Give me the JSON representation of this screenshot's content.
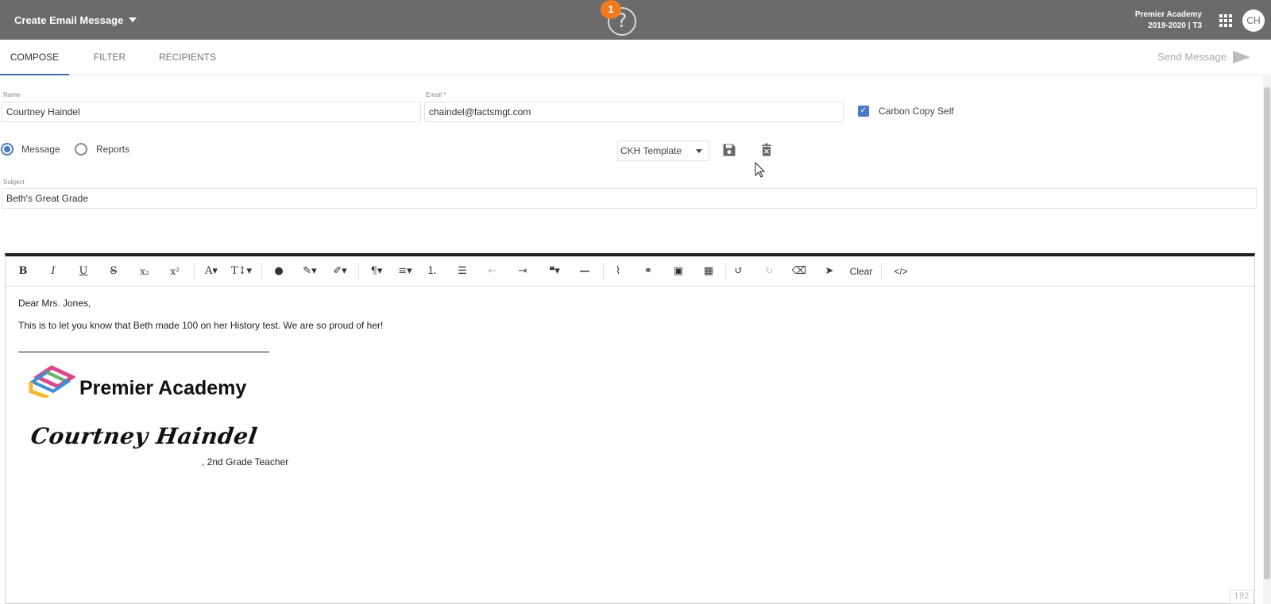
{
  "header": {
    "title": "Create Email Message",
    "help_badge": "1",
    "help_glyph": "?",
    "school_name": "Premier Academy",
    "school_term": "2019-2020 | T3",
    "avatar_initials": "CH",
    "bg_color": "#6b6b6b",
    "badge_color": "#f07b1d"
  },
  "tabs": [
    {
      "label": "COMPOSE",
      "active": true
    },
    {
      "label": "FILTER",
      "active": false
    },
    {
      "label": "RECIPIENTS",
      "active": false
    }
  ],
  "send_button": {
    "label": "Send Message",
    "icon": "send-icon"
  },
  "form": {
    "name_label": "Name",
    "name_value": "Courtney Haindel",
    "email_label": "Email *",
    "email_value": "chaindel@factsmgt.com",
    "carbon_copy_label": "Carbon Copy Self",
    "carbon_copy_checked": true,
    "radio_options": [
      {
        "label": "Message",
        "selected": true
      },
      {
        "label": "Reports",
        "selected": false
      }
    ],
    "template_value": "CKH Template",
    "subject_label": "Subject",
    "subject_value": "Beth's Great Grade"
  },
  "toolbar": {
    "items": [
      "bold-icon",
      "italic-icon",
      "underline-icon",
      "strikethrough-icon",
      "subscript-icon",
      "superscript-icon",
      "font-family-icon",
      "font-size-icon",
      "color-drop-icon",
      "brush-icon",
      "highlighter-icon",
      "paragraph-icon",
      "align-icon",
      "ordered-list-icon",
      "unordered-list-icon",
      "outdent-icon",
      "indent-icon",
      "quote-icon",
      "horizontal-rule-icon",
      "attachment-icon",
      "link-icon",
      "image-icon",
      "table-icon",
      "undo-icon",
      "redo-icon",
      "eraser-icon",
      "select-icon",
      "code-view-icon"
    ],
    "clear_label": "Clear"
  },
  "editor": {
    "greeting": "Dear Mrs. Jones,",
    "body": "This is to let you know that Beth made 100 on her History test. We are so proud of her!",
    "logo_text": "Premier Academy",
    "signature": "Courtney Haindel",
    "signature_role": ", 2nd Grade Teacher",
    "char_count": "192"
  },
  "accent_color": "#4c7ac4"
}
